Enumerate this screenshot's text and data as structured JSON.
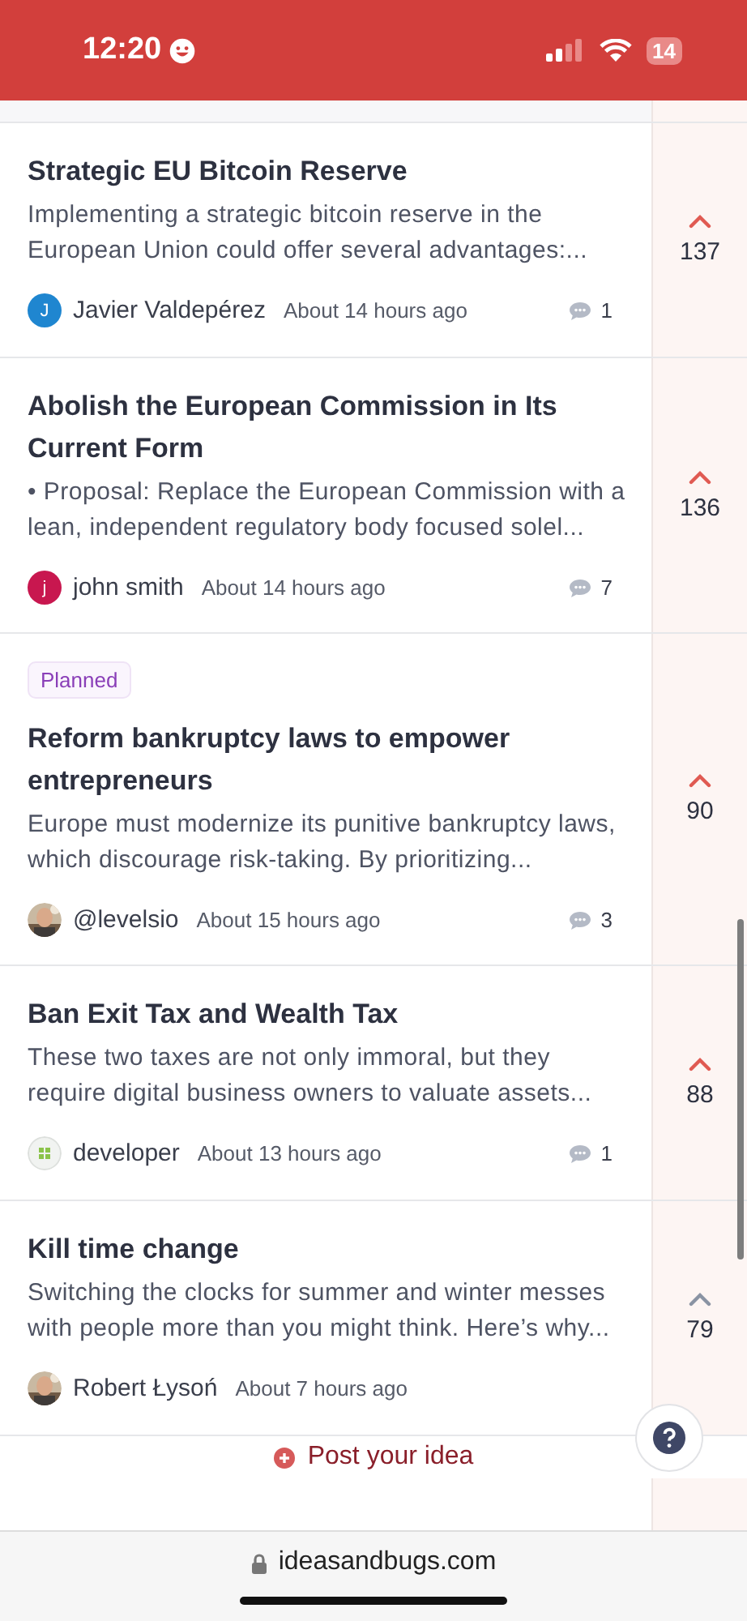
{
  "status_bar": {
    "time": "12:20",
    "battery": "14"
  },
  "ideas": [
    {
      "title": "Strategic EU Bitcoin Reserve",
      "summary": "Implementing a strategic bitcoin reserve in the European Union could offer several advantages:...",
      "author": "Javier Valdepérez",
      "avatar": {
        "kind": "letter",
        "letter": "J",
        "color": "#1f86d0"
      },
      "time": "About 14 hours ago",
      "comments": "1",
      "votes": "137",
      "voted": true
    },
    {
      "title": "Abolish the European Commission in Its Current Form",
      "summary": "• Proposal: Replace the European Commission with a lean, independent regulatory body focused solel...",
      "author": "john smith",
      "avatar": {
        "kind": "letter",
        "letter": "j",
        "color": "#c8174f"
      },
      "time": "About 14 hours ago",
      "comments": "7",
      "votes": "136",
      "voted": true
    },
    {
      "status": "Planned",
      "title": "Reform bankruptcy laws to empower entrepreneurs",
      "summary": "Europe must modernize its punitive bankruptcy laws, which discourage risk-taking. By prioritizing...",
      "author": "@levelsio",
      "time": "About 15 hours ago",
      "comments": "3",
      "votes": "90",
      "voted": true
    },
    {
      "title": "Ban Exit Tax and Wealth Tax",
      "summary": "These two taxes are not only immoral, but they require digital business owners to valuate assets...",
      "author": "developer",
      "avatar": {
        "kind": "grid"
      },
      "time": "About 13 hours ago",
      "comments": "1",
      "votes": "88",
      "voted": true
    },
    {
      "title": "Kill time change",
      "summary": "Switching the clocks for summer and winter messes with people more than you might think. Here’s why...",
      "author": "Robert Łysoń",
      "time": "About 7 hours ago",
      "votes": "79",
      "voted": false
    }
  ],
  "post_button": "Post your idea",
  "browser": {
    "url": "ideasandbugs.com"
  }
}
